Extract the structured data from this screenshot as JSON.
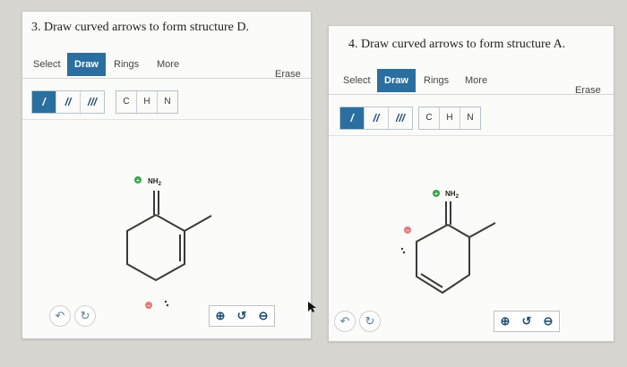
{
  "left": {
    "question": "3. Draw curved arrows to form structure D.",
    "tabs": [
      "Select",
      "Draw",
      "Rings",
      "More"
    ],
    "active_tab": "Draw",
    "erase": "Erase",
    "bond_tools": [
      "/",
      "//",
      "///"
    ],
    "atom_tools": [
      "C",
      "H",
      "N"
    ],
    "substituent": "NH",
    "substituent_sub": "2"
  },
  "right": {
    "question": "4. Draw curved arrows to form structure A.",
    "tabs": [
      "Select",
      "Draw",
      "Rings",
      "More"
    ],
    "active_tab": "Draw",
    "erase": "Erase",
    "bond_tools": [
      "/",
      "//",
      "///"
    ],
    "atom_tools": [
      "C",
      "H",
      "N"
    ],
    "substituent": "NH",
    "substituent_sub": "2"
  },
  "charges": {
    "plus": "+",
    "minus": "−"
  },
  "icons": {
    "undo": "undo-icon",
    "redo": "redo-icon",
    "zoom_in": "zoom-in-icon",
    "reset": "reset-view-icon",
    "zoom_out": "zoom-out-icon"
  },
  "colors": {
    "accent": "#2a6fa0",
    "plus_charge": "#37a24a",
    "minus_charge": "#e27b7b",
    "bond": "#3a3a3a"
  }
}
